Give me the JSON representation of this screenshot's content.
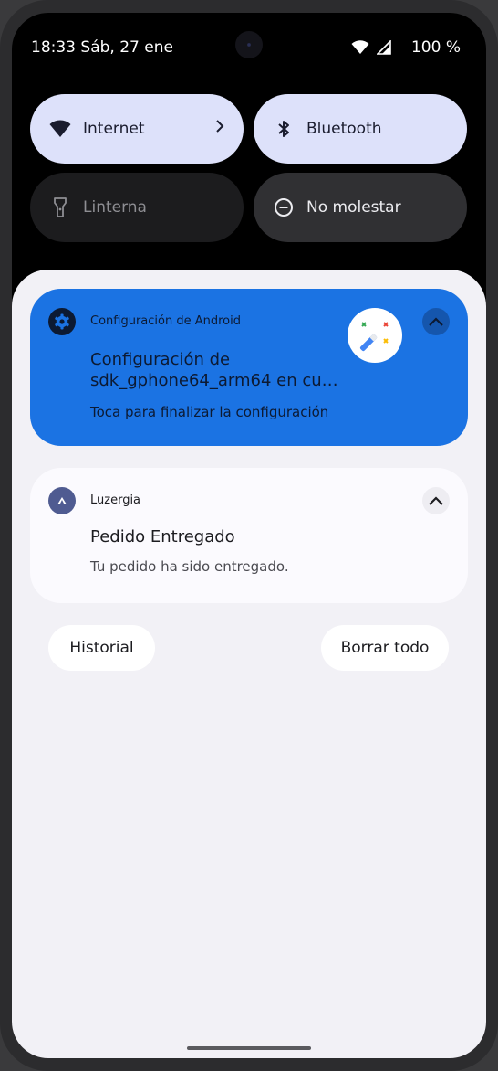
{
  "status_bar": {
    "time": "18:33",
    "date": "Sáb, 27 ene",
    "battery": "100 %",
    "icons": [
      "wifi-icon",
      "cellular-signal-icon"
    ]
  },
  "quick_settings": [
    {
      "label": "Internet",
      "icon": "wifi-icon",
      "state": "on",
      "has_chevron": true
    },
    {
      "label": "Bluetooth",
      "icon": "bluetooth-icon",
      "state": "on"
    },
    {
      "label": "Linterna",
      "icon": "flashlight-icon",
      "state": "off"
    },
    {
      "label": "No molestar",
      "icon": "do-not-disturb-icon",
      "state": "off"
    }
  ],
  "notifications": [
    {
      "app_name": "Configuración de Android",
      "app_icon": "gear-icon",
      "title": "Configuración de sdk_gphone64_arm64 en cu…",
      "body": "Toca para finalizar la configuración",
      "large_icon": "setup-wand-icon",
      "background": "#1b73e3"
    },
    {
      "app_name": "Luzergia",
      "app_icon": "app-logo-icon",
      "title": "Pedido Entregado",
      "body": "Tu pedido ha sido entregado.",
      "background": "#fbfafe"
    }
  ],
  "actions": {
    "history": "Historial",
    "clear_all": "Borrar todo"
  },
  "colors": {
    "tile_on": "#dde1fa",
    "shade_bg": "#f2f1f6",
    "accent_blue": "#1b73e3"
  }
}
